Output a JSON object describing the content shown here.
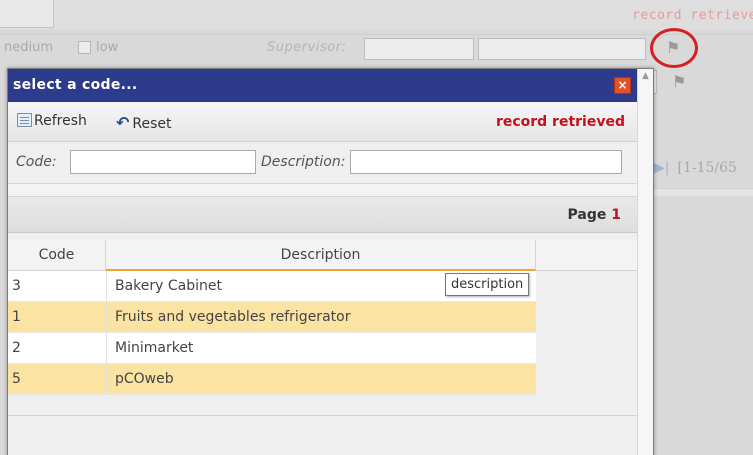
{
  "background": {
    "status_text": "record retrieve",
    "priority_medium_label": "nedium",
    "priority_low_label": "low",
    "supervisor_label": "Supervisor:",
    "pager_text": "[1-15/65"
  },
  "dialog": {
    "title": "select a code...",
    "close_label": "×",
    "toolbar": {
      "refresh_label": "Refresh",
      "reset_label": "Reset",
      "status": "record retrieved"
    },
    "filters": {
      "code_label": "Code:",
      "code_value": "",
      "description_label": "Description:",
      "description_value": ""
    },
    "pager": {
      "label": "Page",
      "page": "1"
    },
    "grid": {
      "columns": [
        "Code",
        "Description"
      ],
      "rows": [
        {
          "code": "3",
          "description": "Bakery Cabinet"
        },
        {
          "code": "1",
          "description": "Fruits and vegetables refrigerator"
        },
        {
          "code": "2",
          "description": "Minimarket"
        },
        {
          "code": "5",
          "description": "pCOweb"
        }
      ]
    },
    "tooltip": "description"
  },
  "colors": {
    "title_bar": "#2d3b8c",
    "status_red": "#c3111c",
    "row_highlight": "#fbe3a4",
    "header_accent": "#f0a23a",
    "annotation_circle": "#d42020"
  }
}
